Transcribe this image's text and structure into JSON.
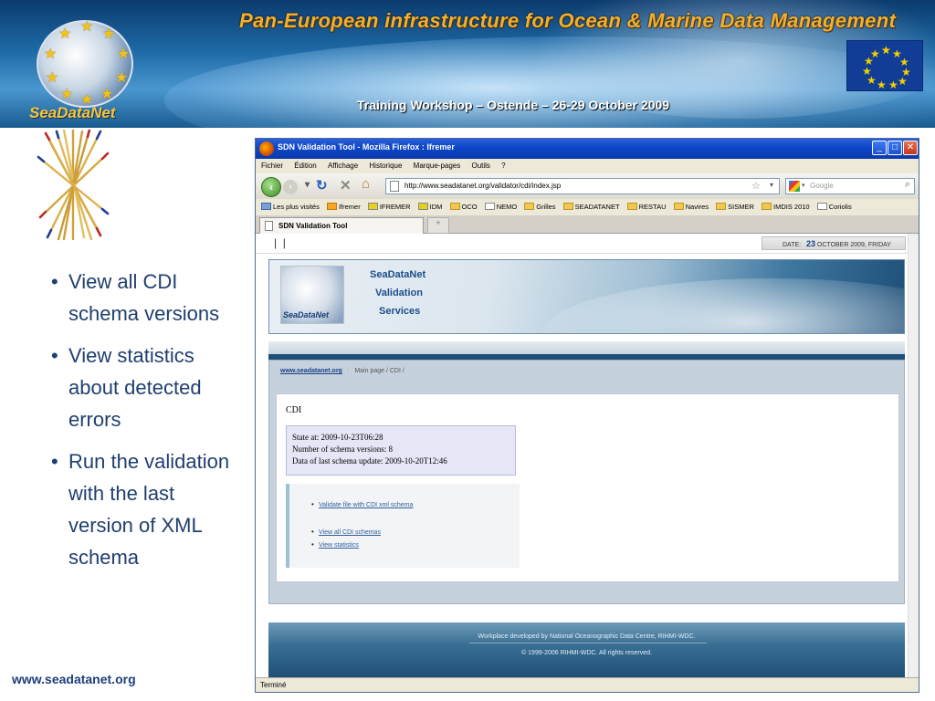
{
  "slide": {
    "banner_title": "Pan-European infrastructure for Ocean & Marine Data Management",
    "banner_subtitle": "Training Workshop – Ostende – 26-29 October 2009",
    "logo_text": "SeaDataNet",
    "bullets": [
      "View all CDI schema versions",
      "View statistics about detected errors",
      "Run the validation with the last version of XML schema"
    ],
    "bullet_glyph": "•",
    "footer_url": "www.seadatanet.org"
  },
  "browser": {
    "window_title": "SDN Validation Tool - Mozilla Firefox : Ifremer",
    "menu": [
      "Fichier",
      "Édition",
      "Affichage",
      "Historique",
      "Marque-pages",
      "Outils",
      "?"
    ],
    "url": "http://www.seadatanet.org/validator/cdi/index.jsp",
    "search_placeholder": "Google",
    "bookmarks": [
      "Les plus visités",
      "Ifremer",
      "IFREMER",
      "IDM",
      "OCO",
      "NEMO",
      "Grilles",
      "SEADATANET",
      "RESTAU",
      "Navires",
      "SISMER",
      "IMDIS 2010",
      "Coriolis"
    ],
    "tab_label": "SDN Validation Tool",
    "status_text": "Terminé",
    "icons": {
      "back": "back-arrow-icon",
      "forward": "forward-arrow-icon",
      "reload": "reload-icon",
      "stop": "stop-icon",
      "home": "home-icon"
    }
  },
  "page": {
    "date_label": "DATE:",
    "date_day": "23",
    "date_rest": "OCTOBER 2009, FRIDAY",
    "app_title_lines": [
      "SeaDataNet",
      "Validation",
      "Services"
    ],
    "logo_text": "SeaDataNet",
    "breadcrumb_home": "www.seadatanet.org",
    "breadcrumb_path": "Main page /    CDI /",
    "section_title": "CDI",
    "state_at": "State at: 2009-10-23T06:28",
    "schema_versions": "Number of schema versions: 8",
    "last_update": "Data of last schema update: 2009-10-20T12:46",
    "links": [
      "Validate file with CDI xml schema",
      "View all CDI schemas",
      "View statistics"
    ],
    "footer_line1": "Workplace developed by National Oceanographic Data Centre, RIHMI-WDC.",
    "footer_line2": "© 1999-2006 RIHMI-WDC. All rights reserved."
  },
  "colors": {
    "banner_title": "#f0b030",
    "bullet_text": "#1f3f6f",
    "link": "#3060a0",
    "stats_bg": "#e5e6f6"
  }
}
